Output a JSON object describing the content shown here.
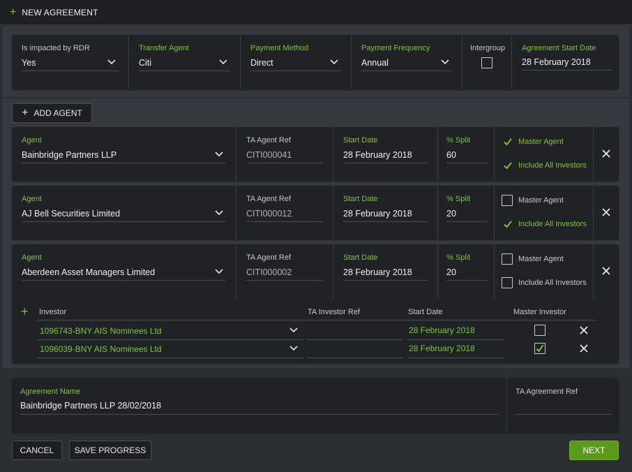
{
  "header": {
    "title": "NEW AGREEMENT"
  },
  "settings": {
    "rdr": {
      "label": "Is impacted by RDR",
      "value": "Yes"
    },
    "transfer_agent": {
      "label": "Transfer Agent",
      "value": "Citi"
    },
    "payment_method": {
      "label": "Payment Method",
      "value": "Direct"
    },
    "payment_frequency": {
      "label": "Payment Frequency",
      "value": "Annual"
    },
    "intergroup": {
      "label": "Intergroup",
      "checked": false
    },
    "start_date": {
      "label": "Agreement Start Date",
      "value": "28 February 2018"
    }
  },
  "add_agent_label": "ADD AGENT",
  "agent_labels": {
    "agent": "Agent",
    "ta_ref": "TA Agent Ref",
    "start_date": "Start Date",
    "split": "% Split",
    "master_agent": "Master Agent",
    "include_all": "Include All Investors"
  },
  "agents": [
    {
      "agent": "Bainbridge Partners LLP",
      "ta_ref": "CITI000041",
      "start_date": "28 February 2018",
      "split": "60",
      "master_agent": true,
      "include_all": true
    },
    {
      "agent": "AJ Bell Securities Limited",
      "ta_ref": "CITI000012",
      "start_date": "28 February 2018",
      "split": "20",
      "master_agent": false,
      "include_all": true
    },
    {
      "agent": "Aberdeen Asset Managers Limited",
      "ta_ref": "CITI000002",
      "start_date": "28 February 2018",
      "split": "20",
      "master_agent": false,
      "include_all": false
    }
  ],
  "investors": {
    "headers": {
      "investor": "Investor",
      "ta_ref": "TA Investor Ref",
      "start_date": "Start Date",
      "master": "Master Investor"
    },
    "rows": [
      {
        "investor": "1096743-BNY AIS Nominees Ltd",
        "ta_ref": "",
        "start_date": "28 February 2018",
        "master": false
      },
      {
        "investor": "1096039-BNY AIS Nominees Ltd",
        "ta_ref": "",
        "start_date": "28 February 2018",
        "master": true
      }
    ]
  },
  "agreement": {
    "name_label": "Agreement Name",
    "name_value": "Bainbridge Partners LLP 28/02/2018",
    "ta_ref_label": "TA Agreement Ref",
    "ta_ref_value": ""
  },
  "footer": {
    "cancel": "CANCEL",
    "save": "SAVE PROGRESS",
    "next": "NEXT"
  },
  "colors": {
    "accent": "#7ec63b",
    "panel": "#202226",
    "background": "#2b2e33",
    "next_button": "#5c9a1d"
  }
}
